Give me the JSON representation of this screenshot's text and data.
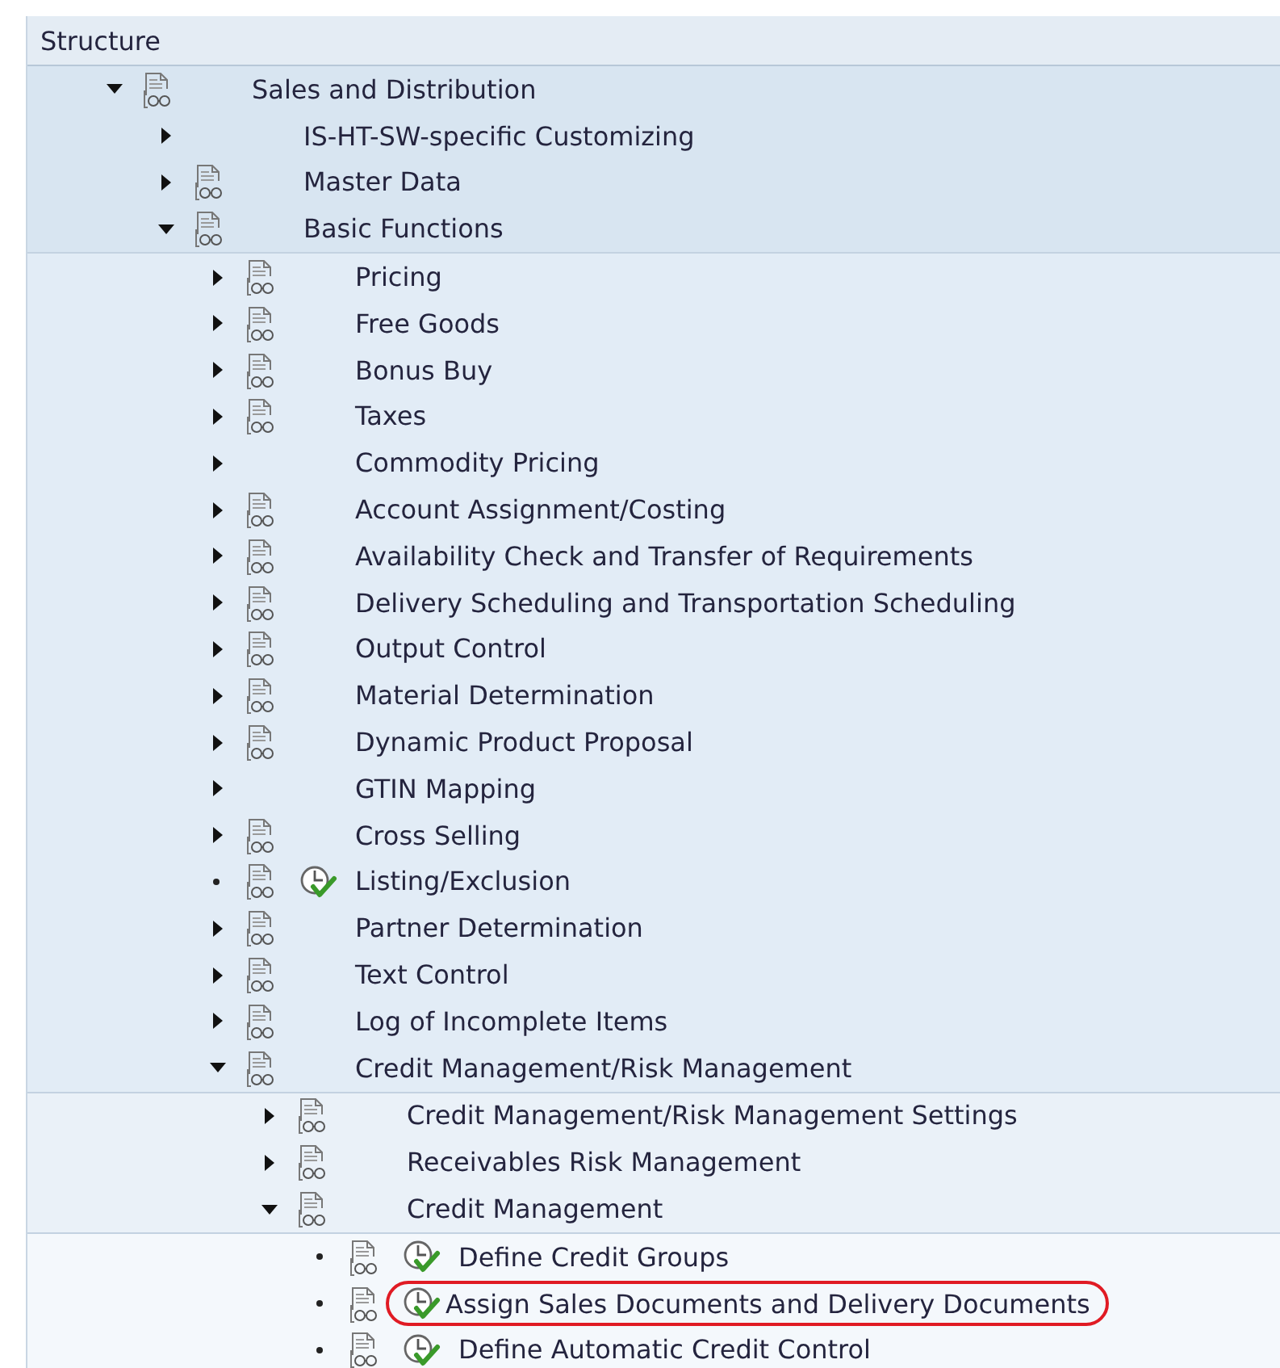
{
  "header": {
    "title": "Structure"
  },
  "tree": [
    {
      "label": "Sales and Distribution",
      "kind": "folder",
      "expanded": true,
      "documented": true,
      "children": [
        {
          "label": "IS-HT-SW-specific Customizing",
          "kind": "folder",
          "expanded": false,
          "documented": false
        },
        {
          "label": "Master Data",
          "kind": "folder",
          "expanded": false,
          "documented": true
        },
        {
          "label": "Basic Functions",
          "kind": "folder",
          "expanded": true,
          "documented": true,
          "children": [
            {
              "label": "Pricing",
              "kind": "folder",
              "expanded": false,
              "documented": true
            },
            {
              "label": "Free Goods",
              "kind": "folder",
              "expanded": false,
              "documented": true
            },
            {
              "label": "Bonus Buy",
              "kind": "folder",
              "expanded": false,
              "documented": true
            },
            {
              "label": "Taxes",
              "kind": "folder",
              "expanded": false,
              "documented": true
            },
            {
              "label": "Commodity Pricing",
              "kind": "folder",
              "expanded": false,
              "documented": false
            },
            {
              "label": "Account Assignment/Costing",
              "kind": "folder",
              "expanded": false,
              "documented": true
            },
            {
              "label": "Availability Check and Transfer of Requirements",
              "kind": "folder",
              "expanded": false,
              "documented": true
            },
            {
              "label": "Delivery Scheduling and Transportation Scheduling",
              "kind": "folder",
              "expanded": false,
              "documented": true
            },
            {
              "label": "Output Control",
              "kind": "folder",
              "expanded": false,
              "documented": true
            },
            {
              "label": "Material Determination",
              "kind": "folder",
              "expanded": false,
              "documented": true
            },
            {
              "label": "Dynamic Product Proposal",
              "kind": "folder",
              "expanded": false,
              "documented": true
            },
            {
              "label": "GTIN Mapping",
              "kind": "folder",
              "expanded": false,
              "documented": false
            },
            {
              "label": "Cross Selling",
              "kind": "folder",
              "expanded": false,
              "documented": true
            },
            {
              "label": "Listing/Exclusion",
              "kind": "activity",
              "documented": true,
              "highlighted": false
            },
            {
              "label": "Partner Determination",
              "kind": "folder",
              "expanded": false,
              "documented": true
            },
            {
              "label": "Text Control",
              "kind": "folder",
              "expanded": false,
              "documented": true
            },
            {
              "label": "Log of Incomplete Items",
              "kind": "folder",
              "expanded": false,
              "documented": true
            },
            {
              "label": "Credit Management/Risk Management",
              "kind": "folder",
              "expanded": true,
              "documented": true,
              "children": [
                {
                  "label": "Credit Management/Risk Management Settings",
                  "kind": "folder",
                  "expanded": false,
                  "documented": true
                },
                {
                  "label": "Receivables Risk Management",
                  "kind": "folder",
                  "expanded": false,
                  "documented": true
                },
                {
                  "label": "Credit Management",
                  "kind": "folder",
                  "expanded": true,
                  "documented": true,
                  "children": [
                    {
                      "label": "Define Credit Groups",
                      "kind": "activity",
                      "documented": true,
                      "highlighted": false
                    },
                    {
                      "label": "Assign Sales Documents and Delivery Documents",
                      "kind": "activity",
                      "documented": true,
                      "highlighted": true
                    },
                    {
                      "label": "Define Automatic Credit Control",
                      "kind": "activity",
                      "documented": true,
                      "highlighted": false
                    }
                  ]
                }
              ]
            }
          ]
        }
      ]
    }
  ]
}
